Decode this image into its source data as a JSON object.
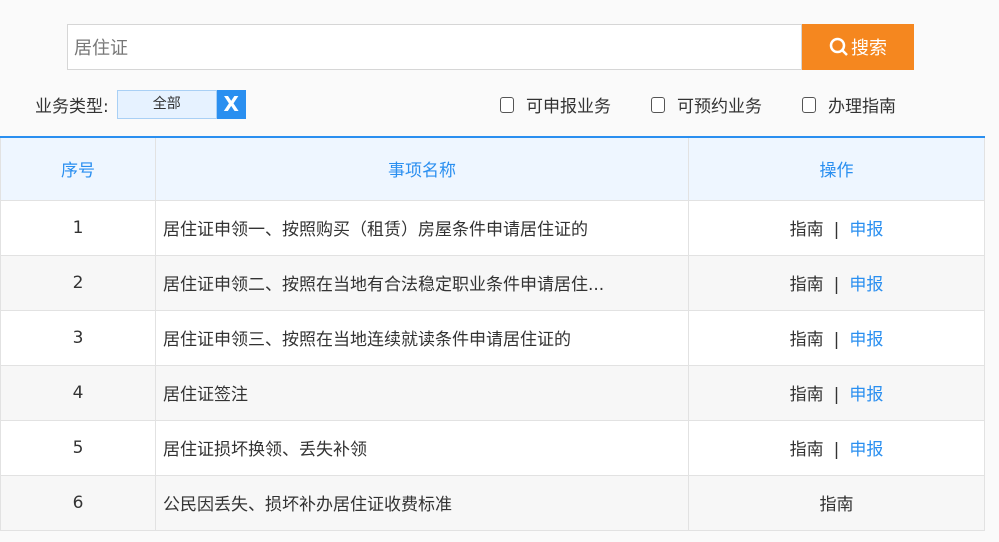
{
  "search": {
    "value": "居住证",
    "button": "搜索"
  },
  "filter": {
    "label": "业务类型:",
    "selected": "全部",
    "clear": "X"
  },
  "checkboxes": [
    "可申报业务",
    "可预约业务",
    "办理指南"
  ],
  "table": {
    "headers": [
      "序号",
      "事项名称",
      "操作"
    ],
    "rows": [
      {
        "no": "1",
        "name": "居住证申领一、按照购买（租赁）房屋条件申请居住证的",
        "guide": "指南",
        "sep": "|",
        "apply": "申报"
      },
      {
        "no": "2",
        "name": "居住证申领二、按照在当地有合法稳定职业条件申请居住...",
        "guide": "指南",
        "sep": "|",
        "apply": "申报"
      },
      {
        "no": "3",
        "name": "居住证申领三、按照在当地连续就读条件申请居住证的",
        "guide": "指南",
        "sep": "|",
        "apply": "申报"
      },
      {
        "no": "4",
        "name": "居住证签注",
        "guide": "指南",
        "sep": "|",
        "apply": "申报"
      },
      {
        "no": "5",
        "name": "居住证损坏换领、丢失补领",
        "guide": "指南",
        "sep": "|",
        "apply": "申报"
      },
      {
        "no": "6",
        "name": "公民因丢失、损坏补办居住证收费标准",
        "guide": "指南"
      }
    ]
  }
}
